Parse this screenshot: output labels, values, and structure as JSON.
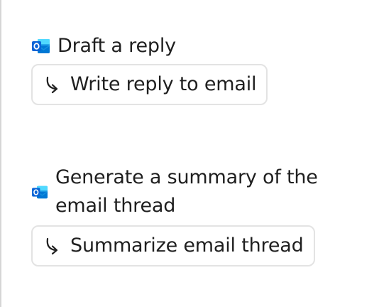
{
  "colors": {
    "outlook_blue": "#0A64D6",
    "outlook_light": "#28A8EA",
    "border": "#e3e3e3",
    "text": "#1f1f1f"
  },
  "suggestions": [
    {
      "app_icon": "outlook-icon",
      "heading": "Draft a reply",
      "action_icon": "reply-arrow-icon",
      "action_label": "Write reply to email"
    },
    {
      "app_icon": "outlook-icon",
      "heading": "Generate a summary of the email thread",
      "action_icon": "reply-arrow-icon",
      "action_label": "Summarize email thread"
    }
  ]
}
